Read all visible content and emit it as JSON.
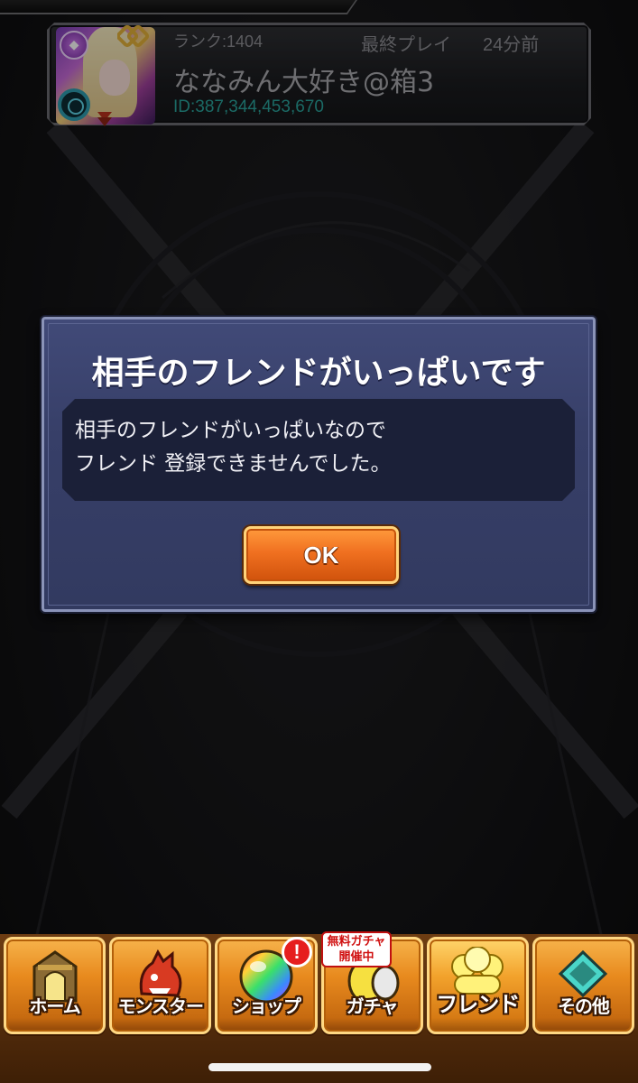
{
  "friend_card": {
    "rank_label": "ランク:1404",
    "last_play_label": "最終プレイ",
    "last_play_time": "24分前",
    "player_name": "ななみん大好き@箱3",
    "player_id": "ID:387,344,453,670"
  },
  "dialog": {
    "title": "相手のフレンドがいっぱいです",
    "message_lines": [
      "相手のフレンドがいっぱいなので",
      "フレンド 登録できませんでした。"
    ],
    "ok_label": "OK"
  },
  "bottom_nav": {
    "items": [
      {
        "label": "ホーム",
        "icon": "home-gate-icon"
      },
      {
        "label": "モンスター",
        "icon": "monster-icon"
      },
      {
        "label": "ショップ",
        "icon": "rainbow-orb-icon"
      },
      {
        "label": "ガチャ",
        "icon": "gacha-egg-icon"
      },
      {
        "label": "フレンド",
        "icon": "friends-icon",
        "active": true
      },
      {
        "label": "その他",
        "icon": "other-diamond-icon"
      }
    ],
    "shop_alert": "!",
    "gacha_badge_lines": [
      "無料ガチャ",
      "開催中"
    ]
  },
  "colors": {
    "dialog_bg": "#3a4270",
    "ok_button": "#f07020",
    "nav_orange": "#e88a1e",
    "player_id": "#2aa39c",
    "alert_red": "#e61e1e"
  }
}
